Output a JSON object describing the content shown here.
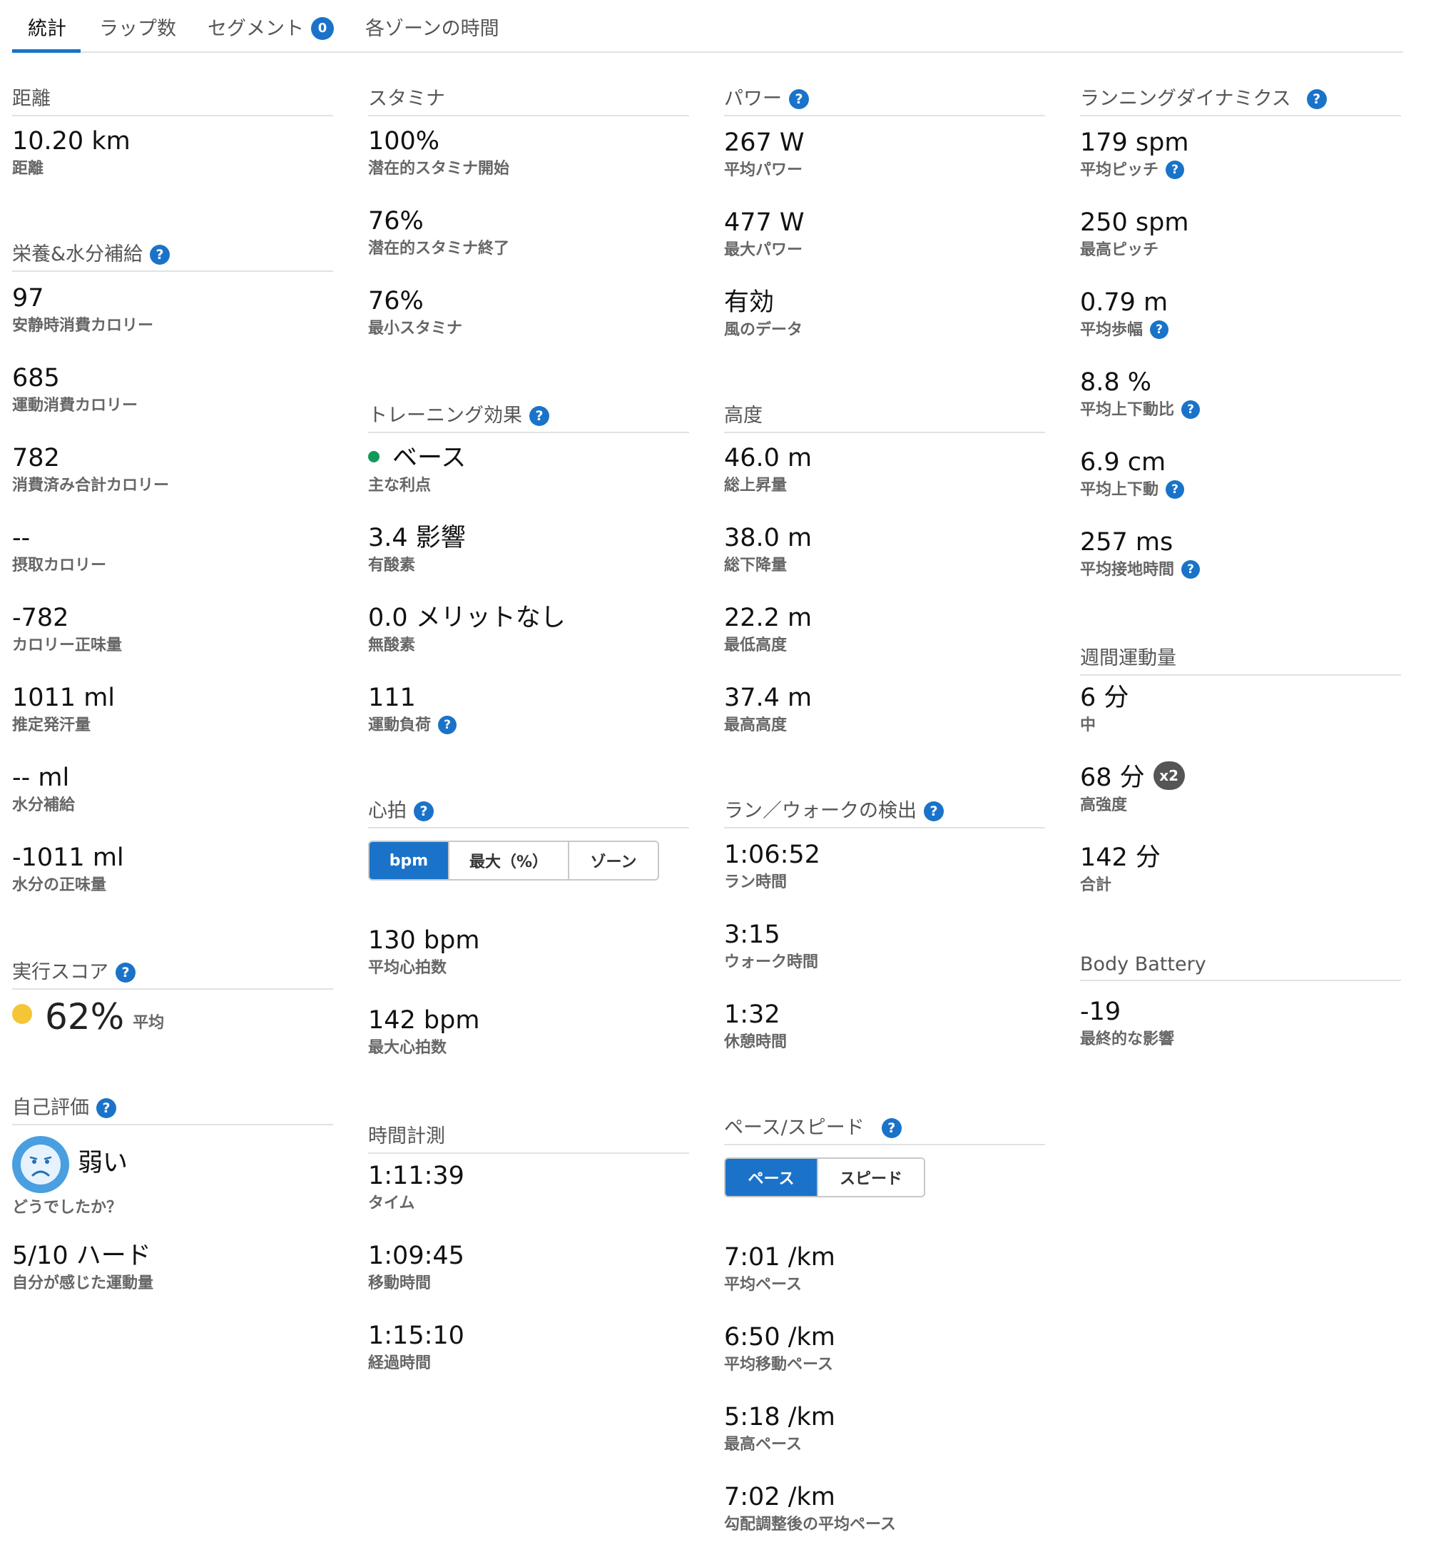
{
  "tabs": [
    {
      "label": "統計",
      "active": true
    },
    {
      "label": "ラップ数"
    },
    {
      "label": "セグメント",
      "badge": "0"
    },
    {
      "label": "各ゾーンの時間"
    }
  ],
  "help_glyph": "?",
  "distance": {
    "title": "距離",
    "value": "10.20 km",
    "label": "距離"
  },
  "nutrition": {
    "title": "栄養&水分補給",
    "items": [
      {
        "value": "97",
        "label": "安静時消費カロリー"
      },
      {
        "value": "685",
        "label": "運動消費カロリー"
      },
      {
        "value": "782",
        "label": "消費済み合計カロリー"
      },
      {
        "value": "--",
        "label": "摂取カロリー"
      },
      {
        "value": "-782",
        "label": "カロリー正味量"
      },
      {
        "value": "1011 ml",
        "label": "推定発汗量"
      },
      {
        "value": "-- ml",
        "label": "水分補給"
      },
      {
        "value": "-1011 ml",
        "label": "水分の正味量"
      }
    ]
  },
  "execution_score": {
    "title": "実行スコア",
    "value": "62%",
    "label": "平均",
    "dot_color": "#f4c534"
  },
  "self_eval": {
    "title": "自己評価",
    "feeling": "弱い",
    "feeling_label": "どうでしたか？",
    "effort_value": "5/10 ハード",
    "effort_label": "自分が感じた運動量"
  },
  "stamina": {
    "title": "スタミナ",
    "items": [
      {
        "value": "100%",
        "label": "潜在的スタミナ開始"
      },
      {
        "value": "76%",
        "label": "潜在的スタミナ終了"
      },
      {
        "value": "76%",
        "label": "最小スタミナ"
      }
    ]
  },
  "training_effect": {
    "title": "トレーニング効果",
    "benefit_value": "ベース",
    "benefit_label": "主な利点",
    "benefit_dot_color": "#139a5b",
    "aerobic_value": "3.4 影響",
    "aerobic_label": "有酸素",
    "anaerobic_value": "0.0 メリットなし",
    "anaerobic_label": "無酸素",
    "load_value": "111",
    "load_label": "運動負荷"
  },
  "heart_rate": {
    "title": "心拍",
    "toggle": [
      "bpm",
      "最大（%）",
      "ゾーン"
    ],
    "items": [
      {
        "value": "130 bpm",
        "label": "平均心拍数"
      },
      {
        "value": "142 bpm",
        "label": "最大心拍数"
      }
    ]
  },
  "timing": {
    "title": "時間計測",
    "items": [
      {
        "value": "1:11:39",
        "label": "タイム"
      },
      {
        "value": "1:09:45",
        "label": "移動時間"
      },
      {
        "value": "1:15:10",
        "label": "経過時間"
      }
    ]
  },
  "power": {
    "title": "パワー",
    "items": [
      {
        "value": "267 W",
        "label": "平均パワー"
      },
      {
        "value": "477 W",
        "label": "最大パワー"
      },
      {
        "value": "有効",
        "label": "風のデータ"
      }
    ]
  },
  "elevation": {
    "title": "高度",
    "items": [
      {
        "value": "46.0 m",
        "label": "総上昇量"
      },
      {
        "value": "38.0 m",
        "label": "総下降量"
      },
      {
        "value": "22.2 m",
        "label": "最低高度"
      },
      {
        "value": "37.4 m",
        "label": "最高高度"
      }
    ]
  },
  "run_walk": {
    "title": "ラン／ウォークの検出",
    "items": [
      {
        "value": "1:06:52",
        "label": "ラン時間"
      },
      {
        "value": "3:15",
        "label": "ウォーク時間"
      },
      {
        "value": "1:32",
        "label": "休憩時間"
      }
    ]
  },
  "pace": {
    "title": "ペース/スピード",
    "toggle": [
      "ペース",
      "スピード"
    ],
    "items": [
      {
        "value": "7:01 /km",
        "label": "平均ペース"
      },
      {
        "value": "6:50 /km",
        "label": "平均移動ペース"
      },
      {
        "value": "5:18 /km",
        "label": "最高ペース"
      },
      {
        "value": "7:02 /km",
        "label": "勾配調整後の平均ペース"
      }
    ]
  },
  "running_dynamics": {
    "title": "ランニングダイナミクス",
    "items": [
      {
        "value": "179 spm",
        "label": "平均ピッチ"
      },
      {
        "value": "250 spm",
        "label": "最高ピッチ"
      },
      {
        "value": "0.79 m",
        "label": "平均歩幅"
      },
      {
        "value": "8.8 %",
        "label": "平均上下動比"
      },
      {
        "value": "6.9 cm",
        "label": "平均上下動"
      },
      {
        "value": "257 ms",
        "label": "平均接地時間"
      }
    ]
  },
  "weekly_intensity": {
    "title": "週間運動量",
    "items": [
      {
        "value": "6 分",
        "label": "中"
      },
      {
        "value": "68 分",
        "label": "高強度",
        "badge": "x2"
      },
      {
        "value": "142 分",
        "label": "合計"
      }
    ]
  },
  "body_battery": {
    "title": "Body Battery",
    "value": "-19",
    "label": "最終的な影響"
  }
}
